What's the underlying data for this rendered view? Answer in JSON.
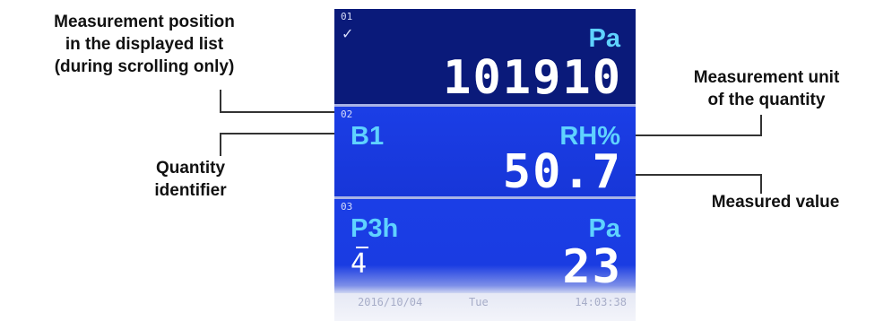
{
  "annotations": {
    "position": [
      "Measurement position",
      "in the displayed list",
      "(during scrolling only)"
    ],
    "identifier": [
      "Quantity",
      "identifier"
    ],
    "unit": [
      "Measurement unit",
      "of the quantity"
    ],
    "value": "Measured value"
  },
  "screen": {
    "rows": [
      {
        "index": "01",
        "check": "✓",
        "identifier": "",
        "unit": "Pa",
        "value": "101910",
        "subvalue": ""
      },
      {
        "index": "02",
        "identifier": "B1",
        "unit": "RH%",
        "value": "50.7",
        "subvalue": ""
      },
      {
        "index": "03",
        "identifier": "P3h",
        "unit": "Pa",
        "value": "23",
        "subvalue": "4"
      }
    ],
    "status": {
      "date": "2016/10/04",
      "day": "Tue",
      "time": "14:03:38"
    }
  },
  "colors": {
    "header_row": "#0a1a7a",
    "row_bg": "#1b3ee6",
    "accent_text": "#5fd2ff",
    "value_text": "#ffffff"
  }
}
